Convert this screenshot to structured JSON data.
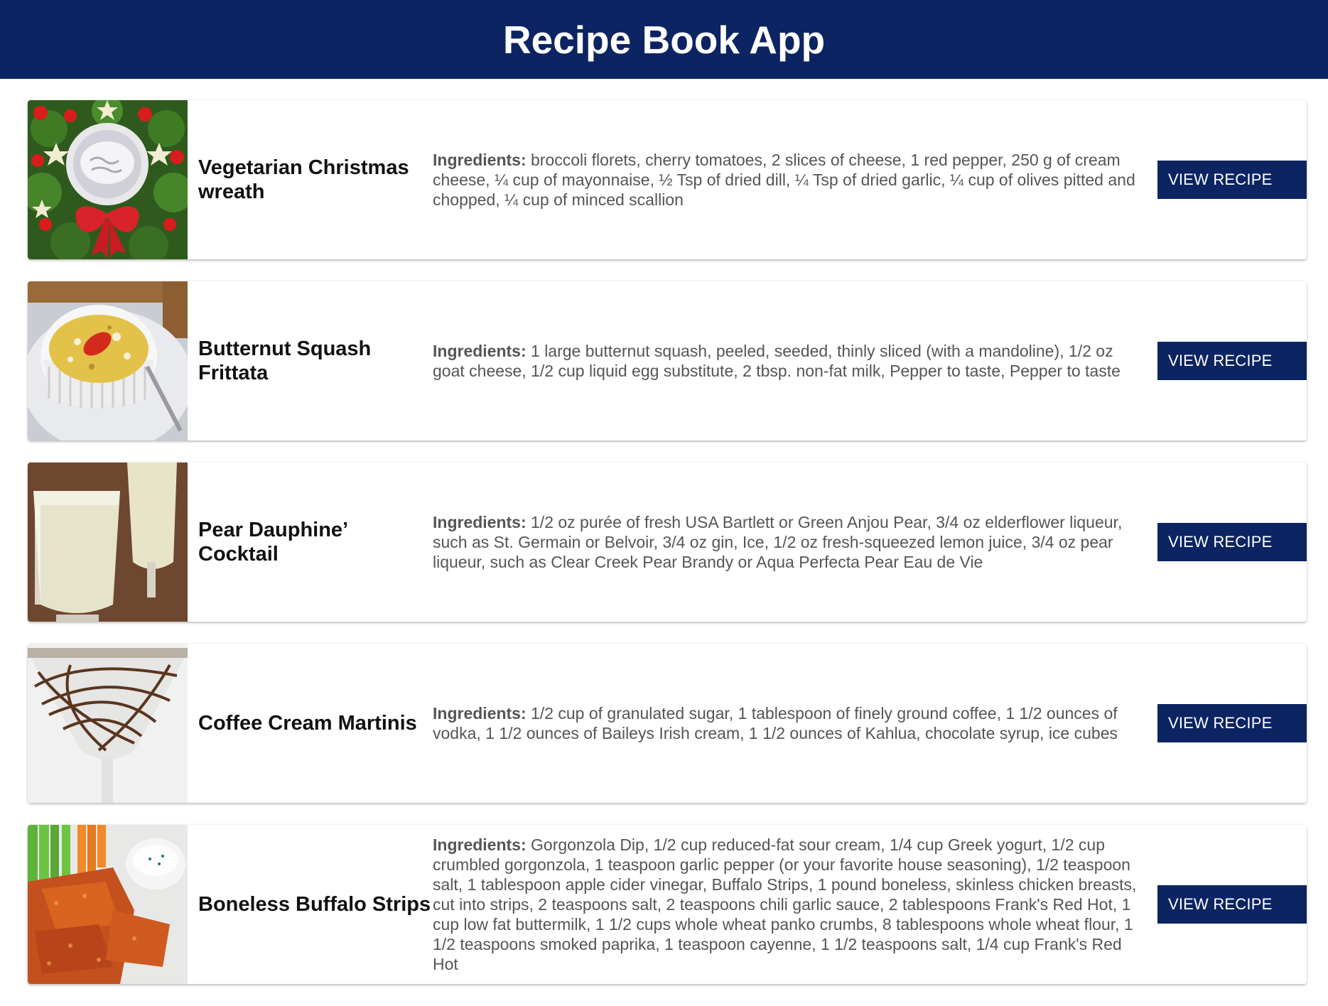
{
  "header": {
    "title": "Recipe Book App"
  },
  "ingredients_label": "Ingredients:",
  "button_label": "VIEW RECIPE",
  "recipes": [
    {
      "title": "Vegetarian Christmas wreath",
      "image": "christmas-wreath-dip-image",
      "ingredients": "broccoli florets, cherry tomatoes, 2 slices of cheese, 1 red pepper, 250 g of cream cheese, ¼ cup of mayonnaise, ½ Tsp of dried dill, ¼ Tsp of dried garlic, ¼ cup of olives pitted and chopped, ¼ cup of minced scallion"
    },
    {
      "title": "Butternut Squash Frittata",
      "image": "frittata-ramekin-image",
      "ingredients": "1 large butternut squash, peeled, seeded, thinly sliced (with a mandoline), 1/2 oz goat cheese, 1/2 cup liquid egg substitute, 2 tbsp. non-fat milk, Pepper to taste, Pepper to taste"
    },
    {
      "title": "Pear Dauphine’ Cocktail",
      "image": "pear-cocktail-glasses-image",
      "ingredients": "1/2 oz purée of fresh USA Bartlett or Green Anjou Pear, 3/4 oz elderflower liqueur, such as St. Germain or Belvoir, 3/4 oz gin, Ice, 1/2 oz fresh-squeezed lemon juice, 3/4 oz pear liqueur, such as Clear Creek Pear Brandy or Aqua Perfecta Pear Eau de Vie"
    },
    {
      "title": "Coffee Cream Martinis",
      "image": "coffee-martini-glass-image",
      "ingredients": "1/2 cup of granulated sugar, 1 tablespoon of finely ground coffee, 1 1/2 ounces of vodka, 1 1/2 ounces of Baileys Irish cream, 1 1/2 ounces of Kahlua, chocolate syrup, ice cubes"
    },
    {
      "title": "Boneless Buffalo Strips",
      "image": "buffalo-strips-plate-image",
      "ingredients": "Gorgonzola Dip, 1/2 cup reduced-fat sour cream, 1/4 cup Greek yogurt, 1/2 cup crumbled gorgonzola, 1 teaspoon garlic pepper (or your favorite house seasoning), 1/2 teaspoon salt, 1 tablespoon apple cider vinegar, Buffalo Strips, 1 pound boneless, skinless chicken breasts, cut into strips, 2 teaspoons salt, 2 teaspoons chili garlic sauce, 2 tablespoons Frank's Red Hot, 1 cup low fat buttermilk, 1 1/2 cups whole wheat panko crumbs, 8 tablespoons whole wheat flour, 1 1/2 teaspoons smoked paprika, 1 teaspoon cayenne, 1 1/2 teaspoons salt, 1/4 cup Frank's Red Hot"
    }
  ]
}
